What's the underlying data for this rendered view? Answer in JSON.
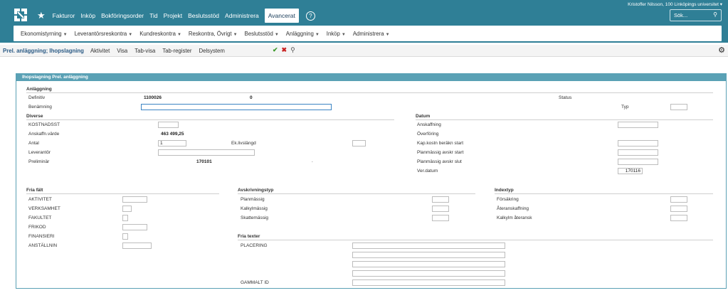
{
  "topbar": {
    "nav": [
      "Fakturor",
      "Inköp",
      "Bokföringsorder",
      "Tid",
      "Projekt",
      "Beslutsstöd",
      "Administrera"
    ],
    "active": "Avancerat",
    "help": "?",
    "user": "Kristoffer Nilsson, 100 Linköpings universitet ▾",
    "search_placeholder": "Sök..."
  },
  "subnav": [
    "Ekonomistyrning",
    "Leverantörsreskontra",
    "Kundreskontra",
    "Reskontra, Övrigt",
    "Beslutsstöd",
    "Anläggning",
    "Inköp",
    "Administrera"
  ],
  "toolbar": {
    "title": "Prel. anläggning; Ihopslagning",
    "menus": [
      "Aktivitet",
      "Visa",
      "Tab-visa",
      "Tab-register",
      "Delsystem"
    ]
  },
  "panel": {
    "header": "Ihopslagning Prel. anläggning",
    "anlaggning": {
      "title": "Anläggning",
      "definitiv_label": "Definitiv",
      "definitiv_value": "1100026",
      "definitiv_value2": "0",
      "status_label": "Status",
      "benamning_label": "Benämning",
      "typ_label": "Typ"
    },
    "diverse": {
      "title": "Diverse",
      "kostnadsst": "KOSTNADSST",
      "anskaffn_label": "Anskaffn.värde",
      "anskaffn_value": "463 499,25",
      "antal_label": "Antal",
      "antal_value": "1",
      "ek_label": "Ek.livslängd",
      "leverantor": "Leverantör",
      "prelim_label": "Preliminär",
      "prelim_value": "170101",
      "dot": "."
    },
    "datum": {
      "title": "Datum",
      "anskaffning": "Anskaffning",
      "overforing": "Överföring",
      "kap": "Kap.kostn beräkn start",
      "plan_start": "Planmässig avskr start",
      "plan_slut": "Planmässig avskr slut",
      "verdatum": "Ver.datum",
      "verdatum_value": "170116"
    },
    "friafalt": {
      "title": "Fria fält",
      "items": [
        "AKTIVITET",
        "VERKSAMHET",
        "FAKULTET",
        "FRIKOD",
        "FINANSIERI",
        "ANSTÄLLNIN"
      ]
    },
    "avskrivning": {
      "title": "Avskrivningstyp",
      "items": [
        "Planmässig",
        "Kalkylmässig",
        "Skattemässig"
      ]
    },
    "indextyp": {
      "title": "Indextyp",
      "items": [
        "Försäkring",
        "Återanskaffning",
        "Kalkylm återansk"
      ]
    },
    "friatexter": {
      "title": "Fria texter",
      "placering": "PLACERING",
      "gammalt": "GAMMALT ID"
    }
  }
}
